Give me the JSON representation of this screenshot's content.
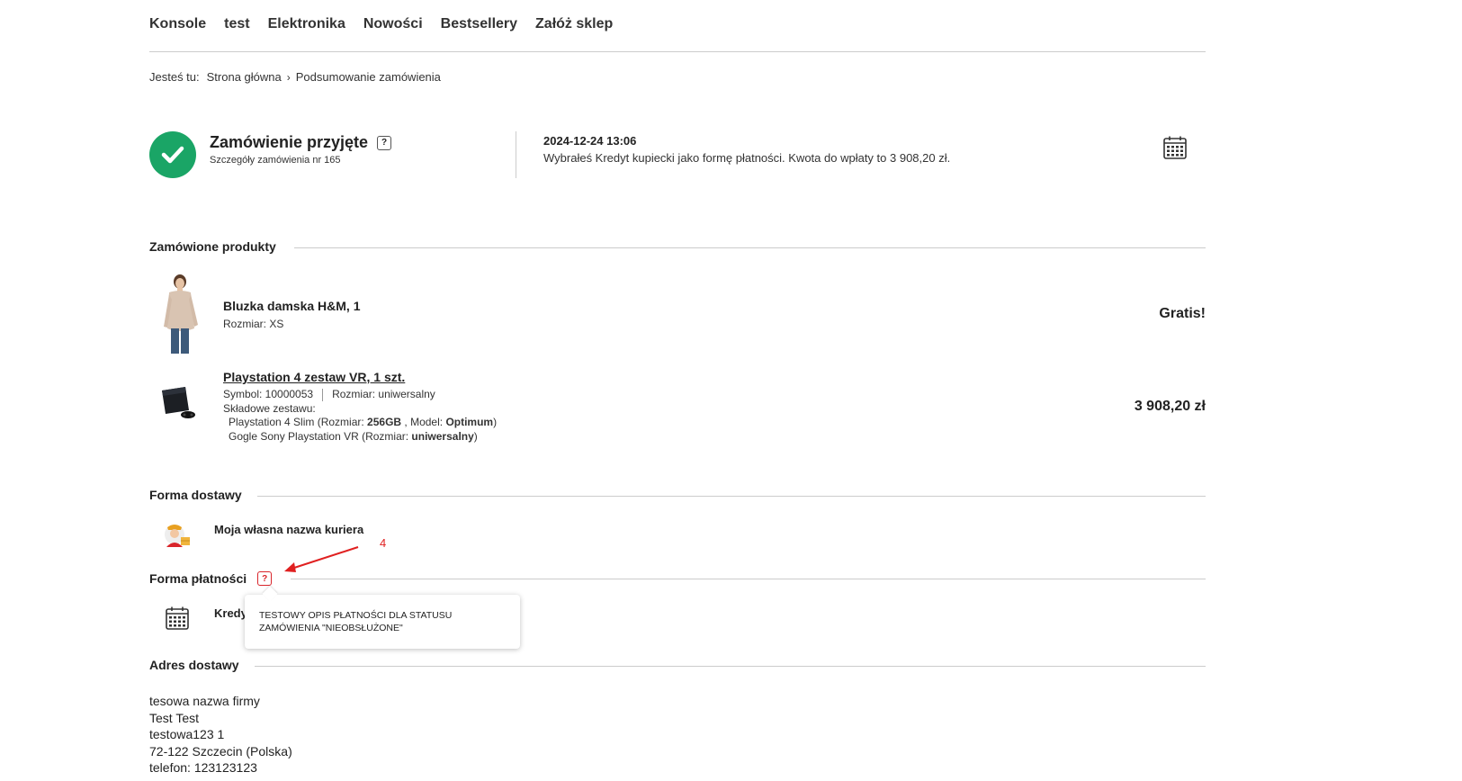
{
  "nav": {
    "items": [
      "Konsole",
      "test",
      "Elektronika",
      "Nowości",
      "Bestsellery",
      "Załóż sklep"
    ]
  },
  "breadcrumb": {
    "prefix": "Jesteś tu:",
    "home": "Strona główna",
    "separator": "›",
    "current": "Podsumowanie zamówienia"
  },
  "order": {
    "status_title": "Zamówienie przyjęte",
    "help_icon_label": "?",
    "details": "Szczegóły zamówienia nr 165",
    "datetime": "2024-12-24 13:06",
    "payment_message": "Wybrałeś Kredyt kupiecki jako formę płatności. Kwota do wpłaty to 3 908,20 zł."
  },
  "products": {
    "section_title": "Zamówione produkty",
    "items": [
      {
        "name": "Bluzka damska H&M, 1",
        "size": "Rozmiar: XS",
        "price": "Gratis!"
      },
      {
        "name": "Playstation 4 zestaw VR, 1 szt.",
        "symbol": "Symbol: 10000053",
        "size": "Rozmiar: uniwersalny",
        "components_label": "Składowe zestawu:",
        "components": [
          {
            "pre": "Playstation 4 Slim (Rozmiar: ",
            "size": "256GB",
            "mid": " , Model: ",
            "model": "Optimum",
            "post": ")"
          },
          {
            "pre": "Gogle Sony Playstation VR (Rozmiar: ",
            "size": "uniwersalny",
            "post": ")"
          }
        ],
        "price": "3 908,20 zł"
      }
    ]
  },
  "delivery": {
    "section_title": "Forma dostawy",
    "method": "Moja własna nazwa kuriera"
  },
  "annotation": {
    "label": "4",
    "color": "#e02020"
  },
  "payment": {
    "section_title": "Forma płatności",
    "help_icon_label": "?",
    "method_partial": "Kredy",
    "tooltip": "TESTOWY OPIS PŁATNOŚCI DLA STATUSU ZAMÓWIENIA \"NIEOBSŁUŻONE\""
  },
  "address": {
    "section_title": "Adres dostawy",
    "lines": [
      "tesowa nazwa firmy",
      "Test Test",
      "testowa123 1",
      "72-122 Szczecin (Polska)",
      "telefon: 123123123"
    ]
  },
  "colors": {
    "accent_green": "#1aa566",
    "help_red": "#d9252b"
  }
}
